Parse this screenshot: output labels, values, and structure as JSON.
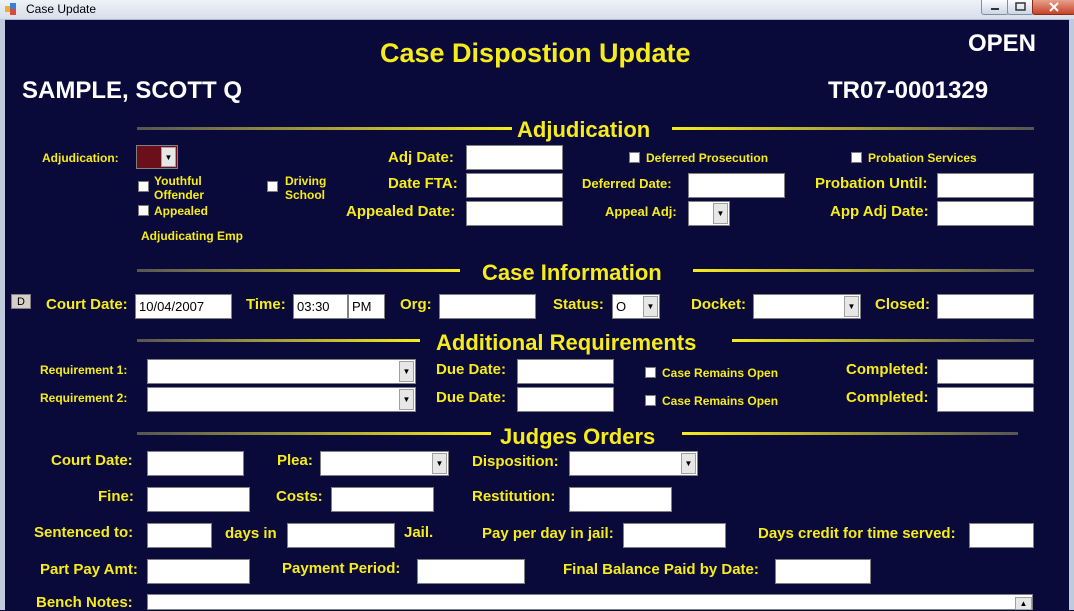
{
  "window": {
    "title": "Case Update"
  },
  "header": {
    "form_title": "Case Dispostion Update",
    "status": "OPEN",
    "defendant_name": "SAMPLE, SCOTT Q",
    "case_number": "TR07-0001329"
  },
  "adjudication": {
    "section_title": "Adjudication",
    "adjudication_label": "Adjudication:",
    "youthful_offender_label": "Youthful\nOffender",
    "youthful_line1": "Youthful",
    "youthful_line2": "Offender",
    "driving_line1": "Driving",
    "driving_line2": "School",
    "appealed_label": "Appealed",
    "adjudicating_emp_label": "Adjudicating Emp",
    "adj_date_label": "Adj Date:",
    "date_fta_label": "Date FTA:",
    "appealed_date_label": "Appealed Date:",
    "deferred_prosecution_label": "Deferred Prosecution",
    "deferred_date_label": "Deferred Date:",
    "appeal_adj_label": "Appeal Adj:",
    "probation_services_label": "Probation Services",
    "probation_until_label": "Probation Until:",
    "app_adj_date_label": "App Adj Date:",
    "adjudication_color": "#6b0f1a"
  },
  "case_info": {
    "section_title": "Case Information",
    "d_button": "D",
    "court_date_label": "Court Date:",
    "court_date": "10/04/2007",
    "time_label": "Time:",
    "time_value": "03:30",
    "ampm": "PM",
    "org_label": "Org:",
    "status_label": "Status:",
    "status_value": "O",
    "docket_label": "Docket:",
    "closed_label": "Closed:"
  },
  "requirements": {
    "section_title": "Additional Requirements",
    "req1_label": "Requirement 1:",
    "req2_label": "Requirement 2:",
    "due_date_label": "Due Date:",
    "remains_open_label": "Case Remains Open",
    "completed_label": "Completed:"
  },
  "orders": {
    "section_title": "Judges Orders",
    "court_date_label": "Court Date:",
    "plea_label": "Plea:",
    "disposition_label": "Disposition:",
    "fine_label": "Fine:",
    "costs_label": "Costs:",
    "restitution_label": "Restitution:",
    "sentenced_label": "Sentenced to:",
    "days_in_label": "days in",
    "jail_label": "Jail.",
    "pay_per_day_label": "Pay per day in jail:",
    "days_credit_label": "Days credit for time served:",
    "part_pay_label": "Part Pay Amt:",
    "payment_period_label": "Payment Period:",
    "final_balance_label": "Final Balance Paid by Date:",
    "bench_notes_label": "Bench Notes:"
  },
  "colors": {
    "background": "#0a0a3a",
    "label": "#f7ec1b",
    "heading": "#ffffff"
  }
}
